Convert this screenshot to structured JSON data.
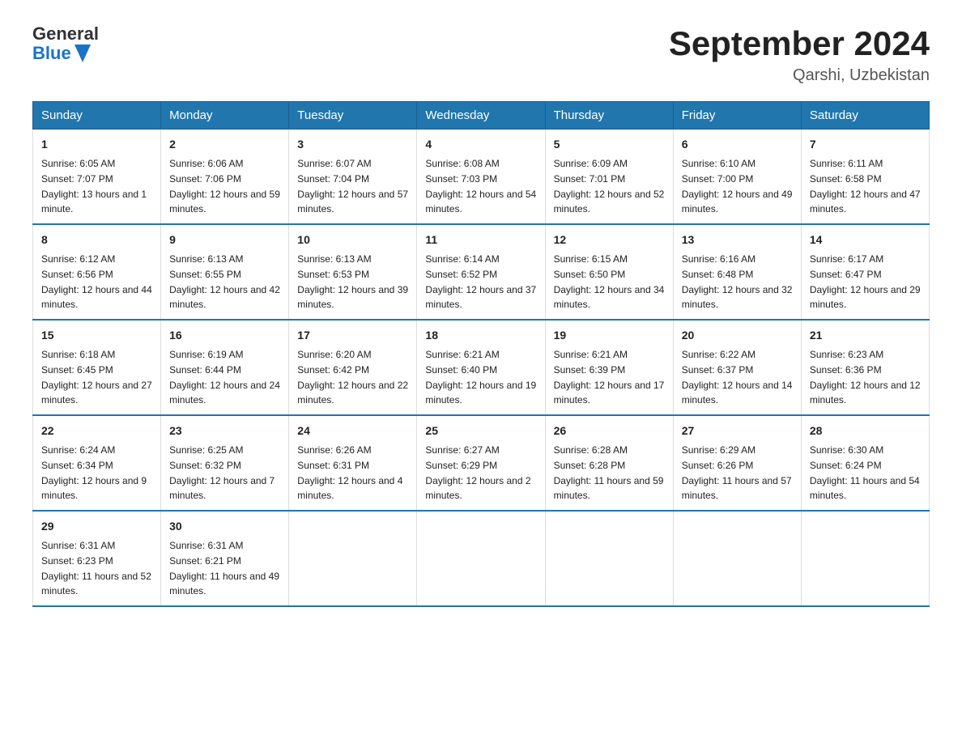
{
  "header": {
    "logo_general": "General",
    "logo_blue": "Blue",
    "month_title": "September 2024",
    "location": "Qarshi, Uzbekistan"
  },
  "days_of_week": [
    "Sunday",
    "Monday",
    "Tuesday",
    "Wednesday",
    "Thursday",
    "Friday",
    "Saturday"
  ],
  "weeks": [
    [
      {
        "day": "1",
        "sunrise": "6:05 AM",
        "sunset": "7:07 PM",
        "daylight": "13 hours and 1 minute."
      },
      {
        "day": "2",
        "sunrise": "6:06 AM",
        "sunset": "7:06 PM",
        "daylight": "12 hours and 59 minutes."
      },
      {
        "day": "3",
        "sunrise": "6:07 AM",
        "sunset": "7:04 PM",
        "daylight": "12 hours and 57 minutes."
      },
      {
        "day": "4",
        "sunrise": "6:08 AM",
        "sunset": "7:03 PM",
        "daylight": "12 hours and 54 minutes."
      },
      {
        "day": "5",
        "sunrise": "6:09 AM",
        "sunset": "7:01 PM",
        "daylight": "12 hours and 52 minutes."
      },
      {
        "day": "6",
        "sunrise": "6:10 AM",
        "sunset": "7:00 PM",
        "daylight": "12 hours and 49 minutes."
      },
      {
        "day": "7",
        "sunrise": "6:11 AM",
        "sunset": "6:58 PM",
        "daylight": "12 hours and 47 minutes."
      }
    ],
    [
      {
        "day": "8",
        "sunrise": "6:12 AM",
        "sunset": "6:56 PM",
        "daylight": "12 hours and 44 minutes."
      },
      {
        "day": "9",
        "sunrise": "6:13 AM",
        "sunset": "6:55 PM",
        "daylight": "12 hours and 42 minutes."
      },
      {
        "day": "10",
        "sunrise": "6:13 AM",
        "sunset": "6:53 PM",
        "daylight": "12 hours and 39 minutes."
      },
      {
        "day": "11",
        "sunrise": "6:14 AM",
        "sunset": "6:52 PM",
        "daylight": "12 hours and 37 minutes."
      },
      {
        "day": "12",
        "sunrise": "6:15 AM",
        "sunset": "6:50 PM",
        "daylight": "12 hours and 34 minutes."
      },
      {
        "day": "13",
        "sunrise": "6:16 AM",
        "sunset": "6:48 PM",
        "daylight": "12 hours and 32 minutes."
      },
      {
        "day": "14",
        "sunrise": "6:17 AM",
        "sunset": "6:47 PM",
        "daylight": "12 hours and 29 minutes."
      }
    ],
    [
      {
        "day": "15",
        "sunrise": "6:18 AM",
        "sunset": "6:45 PM",
        "daylight": "12 hours and 27 minutes."
      },
      {
        "day": "16",
        "sunrise": "6:19 AM",
        "sunset": "6:44 PM",
        "daylight": "12 hours and 24 minutes."
      },
      {
        "day": "17",
        "sunrise": "6:20 AM",
        "sunset": "6:42 PM",
        "daylight": "12 hours and 22 minutes."
      },
      {
        "day": "18",
        "sunrise": "6:21 AM",
        "sunset": "6:40 PM",
        "daylight": "12 hours and 19 minutes."
      },
      {
        "day": "19",
        "sunrise": "6:21 AM",
        "sunset": "6:39 PM",
        "daylight": "12 hours and 17 minutes."
      },
      {
        "day": "20",
        "sunrise": "6:22 AM",
        "sunset": "6:37 PM",
        "daylight": "12 hours and 14 minutes."
      },
      {
        "day": "21",
        "sunrise": "6:23 AM",
        "sunset": "6:36 PM",
        "daylight": "12 hours and 12 minutes."
      }
    ],
    [
      {
        "day": "22",
        "sunrise": "6:24 AM",
        "sunset": "6:34 PM",
        "daylight": "12 hours and 9 minutes."
      },
      {
        "day": "23",
        "sunrise": "6:25 AM",
        "sunset": "6:32 PM",
        "daylight": "12 hours and 7 minutes."
      },
      {
        "day": "24",
        "sunrise": "6:26 AM",
        "sunset": "6:31 PM",
        "daylight": "12 hours and 4 minutes."
      },
      {
        "day": "25",
        "sunrise": "6:27 AM",
        "sunset": "6:29 PM",
        "daylight": "12 hours and 2 minutes."
      },
      {
        "day": "26",
        "sunrise": "6:28 AM",
        "sunset": "6:28 PM",
        "daylight": "11 hours and 59 minutes."
      },
      {
        "day": "27",
        "sunrise": "6:29 AM",
        "sunset": "6:26 PM",
        "daylight": "11 hours and 57 minutes."
      },
      {
        "day": "28",
        "sunrise": "6:30 AM",
        "sunset": "6:24 PM",
        "daylight": "11 hours and 54 minutes."
      }
    ],
    [
      {
        "day": "29",
        "sunrise": "6:31 AM",
        "sunset": "6:23 PM",
        "daylight": "11 hours and 52 minutes."
      },
      {
        "day": "30",
        "sunrise": "6:31 AM",
        "sunset": "6:21 PM",
        "daylight": "11 hours and 49 minutes."
      },
      null,
      null,
      null,
      null,
      null
    ]
  ]
}
